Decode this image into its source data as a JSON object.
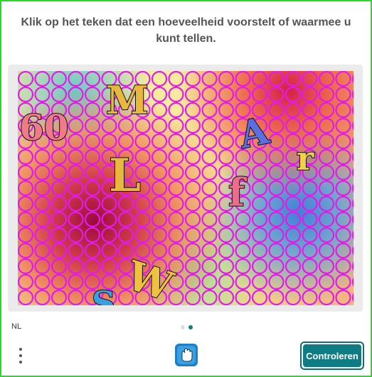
{
  "prompt": "Klik op het teken dat een hoeveelheid voorstelt of waarmee u kunt tellen.",
  "puzzle": {
    "glyphs": [
      {
        "id": "60",
        "text": "60",
        "color": "#f07a8a"
      },
      {
        "id": "M",
        "text": "M",
        "color": "#e9b73c"
      },
      {
        "id": "L",
        "text": "L",
        "color": "#e9b73c"
      },
      {
        "id": "A",
        "text": "A",
        "color": "#5b6fe0"
      },
      {
        "id": "r",
        "text": "r",
        "color": "#f0d24a"
      },
      {
        "id": "f",
        "text": "f",
        "color": "#f06a8a"
      },
      {
        "id": "W",
        "text": "W",
        "color": "#f0c040"
      },
      {
        "id": "S",
        "text": "S",
        "color": "#3aa0e0"
      }
    ],
    "ring_color": "#e21ce8"
  },
  "footer": {
    "language": "NL",
    "dots": [
      {
        "active": false,
        "color": "#dddddd"
      },
      {
        "active": true,
        "color": "#0f7c84"
      }
    ],
    "submit_label": "Controleren"
  },
  "colors": {
    "accent": "#0f7c84",
    "frame": "#22dd22",
    "prompt_text": "#555555"
  }
}
